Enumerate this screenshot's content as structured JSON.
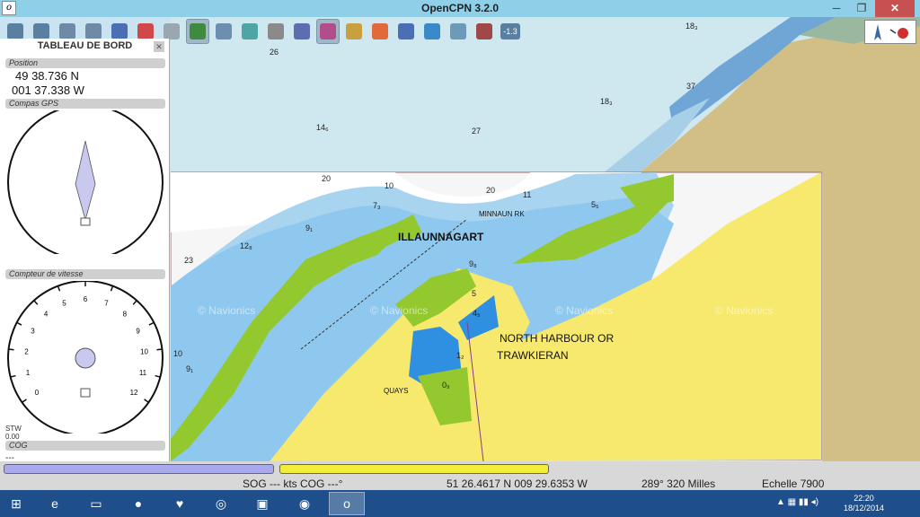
{
  "window": {
    "title": "OpenCPN 3.2.0",
    "minimize": "─",
    "maximize": "❐",
    "close": "✕"
  },
  "toolbar": {
    "tools": [
      {
        "name": "zoom-in-icon",
        "color": "#5a7fa0"
      },
      {
        "name": "zoom-out-icon",
        "color": "#5a7fa0"
      },
      {
        "name": "scale-down-icon",
        "color": "#6d8aa6"
      },
      {
        "name": "scale-up-icon",
        "color": "#6d8aa6"
      },
      {
        "name": "route-icon",
        "color": "#4a6fb5"
      },
      {
        "name": "autofollow-icon",
        "color": "#d04848"
      },
      {
        "name": "settings-icon",
        "color": "#9aa6b2"
      },
      {
        "name": "track-icon",
        "color": "#3f8a3f"
      },
      {
        "name": "text-icon",
        "color": "#6c8eb0"
      },
      {
        "name": "current-icon",
        "color": "#4fa4a4"
      },
      {
        "name": "print-icon",
        "color": "#8a8a8a"
      },
      {
        "name": "route-manager-icon",
        "color": "#5b6fb0"
      },
      {
        "name": "track-manager-icon",
        "color": "#b04d8a"
      },
      {
        "name": "tide-icon",
        "color": "#c8a040"
      },
      {
        "name": "mob-icon",
        "color": "#e06a3a"
      },
      {
        "name": "help-icon",
        "color": "#4a6fb5"
      },
      {
        "name": "ais-icon",
        "color": "#3a8aca"
      },
      {
        "name": "quilt-icon",
        "color": "#6c9ab8"
      },
      {
        "name": "grib-icon",
        "color": "#a04848"
      },
      {
        "name": "zoom-level-icon",
        "color": "#5a7fa0"
      }
    ],
    "zoom_level": "-1.3"
  },
  "dashboard": {
    "title": "TABLEAU DE BORD",
    "close": "✕",
    "position_label": "Position",
    "lat": "49 38.736 N",
    "lon": "001 37.338 W",
    "compass_label": "Compas GPS",
    "speed_label": "Compteur de vitesse",
    "speed_ticks": [
      "0",
      "1",
      "2",
      "3",
      "4",
      "5",
      "6",
      "7",
      "8",
      "9",
      "10",
      "11",
      "12"
    ],
    "stw_label": "STW",
    "stw_value": "0.00",
    "cog_label": "COG",
    "cog_value": "---"
  },
  "chart": {
    "place_labels": [
      "ILLAUNNAGART",
      "NORTH HARBOUR OR",
      "TRAWKIERAN",
      "MINNAUN RK",
      "QUAYS"
    ],
    "soundings": [
      "26",
      "18₃",
      "18₃",
      "14₆",
      "27",
      "37",
      "20",
      "10",
      "20",
      "11",
      "7₃",
      "5₅",
      "9₁",
      "12₈",
      "23",
      "9₈",
      "5",
      "4₅",
      "1₂",
      "0₉",
      "10",
      "9₁"
    ],
    "watermark": "© Navionics"
  },
  "status": {
    "progress_colors": [
      "#a9a9ee",
      "#f2ec3a"
    ],
    "sog": "SOG --- kts  COG ---°",
    "cursor_pos": "51 26.4617 N   009 29.6353 W",
    "bearing_dist": "289°  320 Milles",
    "scale": "Echelle 7900"
  },
  "taskbar": {
    "apps": [
      {
        "name": "start-icon",
        "glyph": "⊞"
      },
      {
        "name": "internet-explorer-icon",
        "glyph": "e"
      },
      {
        "name": "file-explorer-icon",
        "glyph": "▭"
      },
      {
        "name": "media-player-icon",
        "glyph": "●"
      },
      {
        "name": "heart-app-icon",
        "glyph": "♥"
      },
      {
        "name": "globe-app-icon",
        "glyph": "◎"
      },
      {
        "name": "remote-desktop-icon",
        "glyph": "▣"
      },
      {
        "name": "chrome-icon",
        "glyph": "◉"
      },
      {
        "name": "opencpn-icon",
        "glyph": "o"
      }
    ],
    "time": "22:20",
    "date": "18/12/2014"
  }
}
